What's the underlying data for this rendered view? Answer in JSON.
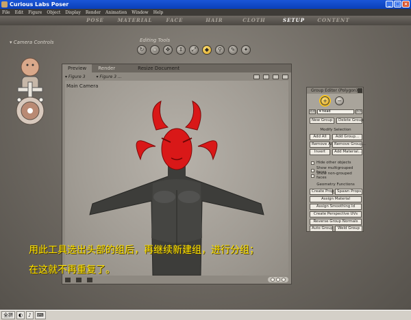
{
  "window": {
    "title": "Curious Labs Poser",
    "min": "_",
    "max": "□",
    "close": "×"
  },
  "menu": [
    "File",
    "Edit",
    "Figure",
    "Object",
    "Display",
    "Render",
    "Animation",
    "Window",
    "Help"
  ],
  "rooms": [
    "POSE",
    "MATERIAL",
    "FACE",
    "HAIR",
    "CLOTH",
    "SETUP",
    "CONTENT"
  ],
  "active_room": "SETUP",
  "camera": {
    "label": "Camera Controls"
  },
  "editing_tools": {
    "label": "Editing Tools",
    "icons": [
      "rotate-icon",
      "twist-icon",
      "translate-icon",
      "translate-in-out-icon",
      "scale-icon",
      "taper-icon",
      "chain-break-icon",
      "color-icon",
      "direct-manipulation-icon"
    ]
  },
  "document": {
    "tabs": {
      "preview": "Preview",
      "render": "Render",
      "resize": "Resize Document"
    },
    "figure_menu_1": "Figure 3",
    "figure_menu_2": "Figure 3 ...",
    "camera_label": "Main Camera"
  },
  "group_editor": {
    "title": "Group Editor (Polygon)",
    "selected_group": "head",
    "buttons": {
      "new_group": "New Group",
      "delete_group": "Delete Group",
      "add_all": "Add All",
      "add_group": "Add Group...",
      "remove_all": "Remove All",
      "remove_group": "Remove Group...",
      "invert": "Invert",
      "add_material": "Add Material...",
      "create_prop": "Create Prop",
      "spawn_props": "Spawn Props",
      "assign_material": "Assign Material",
      "assign_smoothing": "Assign Smoothing Id",
      "create_perspective_uvs": "Create Perspective UVs",
      "reverse_group_normals": "Reverse Group Normals",
      "auto_group": "Auto Group",
      "weld_group": "Weld Group"
    },
    "modify_selection": "Modify Selection",
    "geometry_functions": "Geometry Functions",
    "checks": [
      "Hide other objects",
      "Show multigrouped faces",
      "Show non-grouped faces"
    ]
  },
  "caption": {
    "line1": "用此工具选出头部的组后，再继续新建组，进行分组；",
    "line2": "在这就不再重复了。"
  },
  "taskbar": {
    "items": [
      "全拼",
      "◐",
      "♪",
      "⌨"
    ]
  },
  "colors": {
    "highlight": "#f7c21b",
    "caption": "#ffe400",
    "figure_head": "#d91818"
  }
}
